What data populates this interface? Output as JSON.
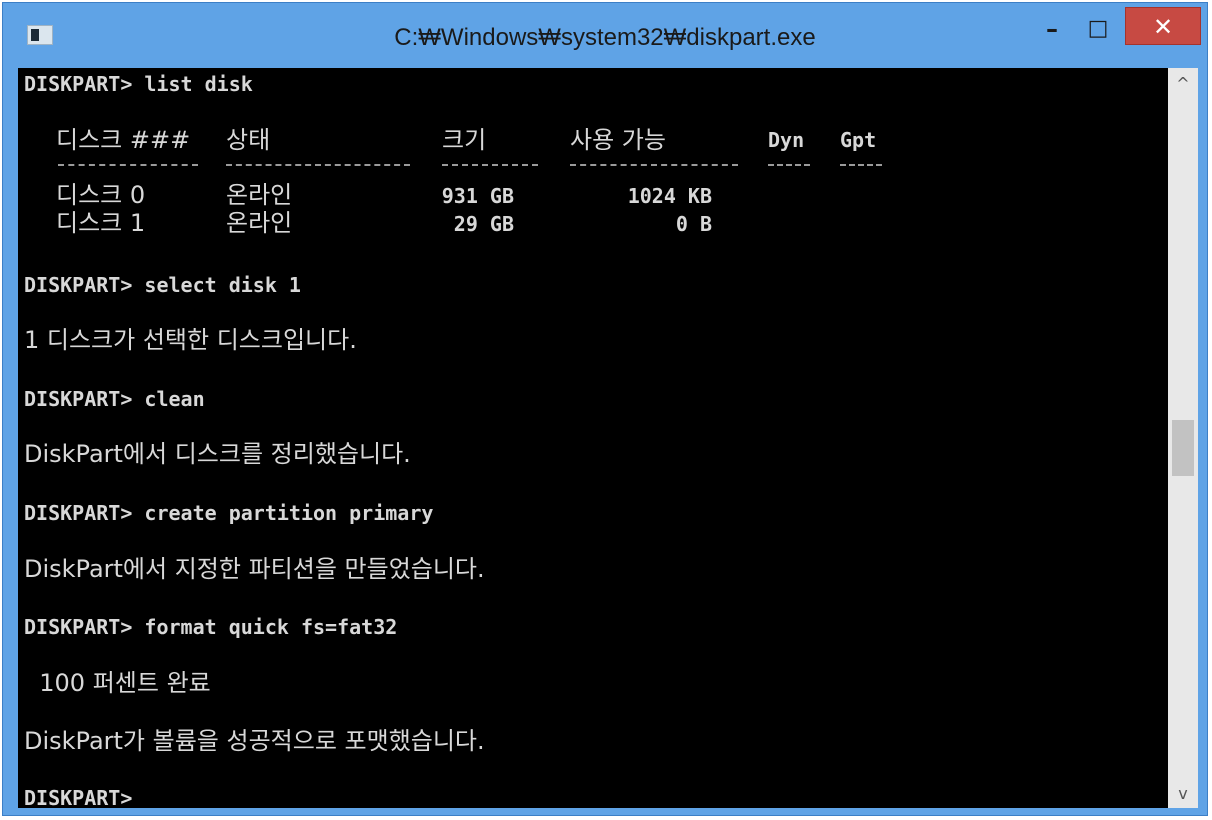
{
  "window": {
    "title": "C:₩Windows₩system32₩diskpart.exe",
    "controls": {
      "minimize": "–",
      "maximize": "□",
      "close": "✕"
    }
  },
  "console": {
    "cmd_list": "DISKPART> list disk",
    "table": {
      "headers": [
        "디스크 ###",
        "상태",
        "크기",
        "사용 가능",
        "Dyn",
        "Gpt"
      ],
      "rows": [
        [
          "디스크 0",
          "온라인",
          "931 GB",
          "1024 KB"
        ],
        [
          "디스크 1",
          "온라인",
          "29 GB",
          "0 B"
        ]
      ]
    },
    "cmd_select": "DISKPART> select disk 1",
    "msg_select": "1 디스크가 선택한 디스크입니다.",
    "cmd_clean": "DISKPART> clean",
    "msg_clean": "DiskPart에서 디스크를 정리했습니다.",
    "cmd_create": "DISKPART> create partition primary",
    "msg_create": "DiskPart에서 지정한 파티션을 만들었습니다.",
    "cmd_format": "DISKPART> format quick fs=fat32",
    "msg_progress": "  100 퍼센트 완료",
    "msg_format": "DiskPart가 볼륨을 성공적으로 포맷했습니다.",
    "prompt": "DISKPART>"
  },
  "scrollbar": {
    "up": "^",
    "down": "v"
  },
  "colors": {
    "titlebar": "#5fa3e6",
    "close_button": "#c74a43",
    "console_bg": "#000000",
    "console_text": "#d8d8d8"
  },
  "icons": [
    "console-app-icon",
    "minimize-icon",
    "maximize-icon",
    "close-icon",
    "scroll-up-arrow-icon",
    "scroll-down-arrow-icon"
  ]
}
